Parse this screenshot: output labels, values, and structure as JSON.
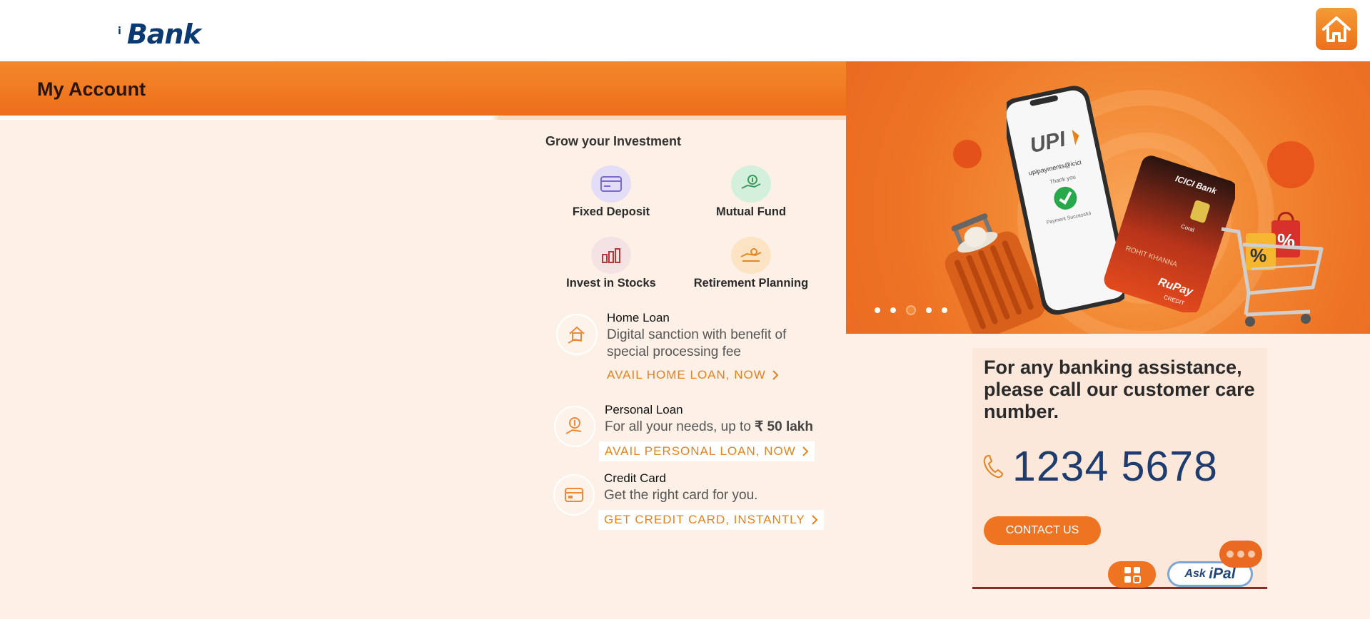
{
  "header": {
    "logo_text": "Bank",
    "logo_mark": "i"
  },
  "page": {
    "title": "My Account"
  },
  "invest": {
    "title": "Grow your Investment",
    "items": [
      {
        "label": "Fixed Deposit",
        "icon": "fixed-deposit-icon"
      },
      {
        "label": "Mutual Fund",
        "icon": "mutual-fund-icon"
      },
      {
        "label": "Invest in Stocks",
        "icon": "stocks-icon"
      },
      {
        "label": "Retirement Planning",
        "icon": "retirement-icon"
      }
    ]
  },
  "offers": [
    {
      "title": "Home Loan",
      "desc_line1": "Digital sanction with benefit of",
      "desc_line2": "special processing fee",
      "cta": "AVAIL HOME LOAN, NOW"
    },
    {
      "title": "Personal Loan",
      "desc_prefix": "For all your needs, up to",
      "desc_amount": "₹ 50 lakh",
      "cta": "AVAIL PERSONAL LOAN, NOW"
    },
    {
      "title": "Credit Card",
      "desc_line1": "Get the right card for you.",
      "cta": "GET CREDIT CARD, INSTANTLY"
    }
  ],
  "banner": {
    "upi_text": "UPI",
    "upi_id": "upipayments@icici",
    "thank_you": "Thank you",
    "payment_status": "Payment Successful",
    "card_bank": "ICICI Bank",
    "card_variant": "Coral",
    "card_holder": "ROHIT KHANNA",
    "card_network": "RuPay",
    "card_type": "CREDIT",
    "slide_count": 5,
    "active_slide": 3
  },
  "care": {
    "text": "For any banking assistance, please call our customer care number.",
    "phone": "1234 5678",
    "contact_label": "CONTACT US"
  },
  "chat": {
    "ask_label": "Ask",
    "ipal_label": "iPal"
  },
  "colors": {
    "brand_orange": "#ee7422",
    "brand_blue": "#0b3a73",
    "panel_bg": "#fdf0e6"
  }
}
